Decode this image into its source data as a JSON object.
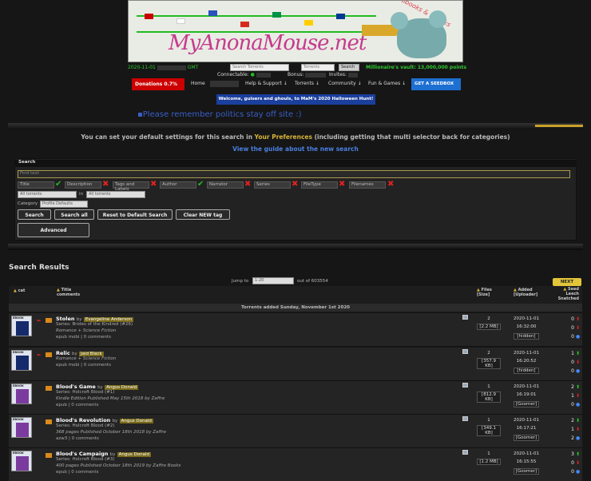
{
  "banner": {
    "logo_text": "MyAnonaMouse.net",
    "tagline": "audiobooks & ebooks"
  },
  "stats": {
    "date_prefix": "2020-11-01",
    "date_suffix": "GMT",
    "search_placeholder": "Search Torrents",
    "search_select": "Torrents",
    "search_button": "Search",
    "wedge_text": "Millionaire's vault: 13,000,000 points",
    "connectable_label": "Connectable:",
    "bonus_label": "Bonus:",
    "invites_label": "Invites:"
  },
  "nav": {
    "donations": "Donations 0.7%",
    "home": "Home",
    "help": "Help & Support ↓",
    "torrents": "Torrents ↓",
    "community": "Community ↓",
    "fun": "Fun & Games ↓",
    "seedbox": "GET A SEEDBOX"
  },
  "halloween": "Welcome, guisers and ghouls, to MaM's 2020 Halloween Hunt!",
  "politics": "Please remember politics stay off site :)",
  "prefs": {
    "pre": "You can set your default settings for this search in ",
    "link": "Your Preferences",
    "post": " (including getting that multi selector back for categories)"
  },
  "guide": "View the guide about the new search",
  "search": {
    "header": "Search",
    "find_placeholder": "Find text",
    "fields": [
      {
        "label": "Title",
        "checked": true
      },
      {
        "label": "Description",
        "checked": false
      },
      {
        "label": "Tags and Labels",
        "checked": false
      },
      {
        "label": "Author",
        "checked": true
      },
      {
        "label": "Narrator",
        "checked": false
      },
      {
        "label": "Series",
        "checked": false
      },
      {
        "label": "FileType",
        "checked": false
      },
      {
        "label": "Filenames",
        "checked": false
      }
    ],
    "scope1": "All torrents",
    "in_label": "in",
    "scope2": "All torrents",
    "category_label": "Category",
    "category_value": "Profile Defaults",
    "btn_search": "Search",
    "btn_search_all": "Search all",
    "btn_reset": "Reset to Default Search",
    "btn_clear": "Clear NEW tag",
    "btn_advanced": "Advanced"
  },
  "results": {
    "title": "Search Results",
    "jump_label": "Jump to",
    "jump_value": "1-20",
    "out_of": "out of 603554",
    "next": "NEXT",
    "col_cat": "cat",
    "col_title": "Title",
    "col_comments": "comments",
    "col_files": "Files",
    "col_size": "[Size]",
    "col_added": "Added",
    "col_uploader": "[Uploader]",
    "col_seed": "Seed",
    "col_leech": "Leech",
    "col_snatched": "Snatched",
    "date_band": "Torrents added Sunday, November 1st 2020"
  },
  "rows": [
    {
      "title": "Stolen",
      "author": "Evangeline Anderson",
      "line2": "Series:  Brides of the Kindred  (#26)",
      "line3": "Romance + Science Fiction",
      "tags": "epub  mobi  | 0 comments",
      "files": "2",
      "size": "[2.2 MB]",
      "date": "2020-11-01",
      "time": "16:32:00",
      "uploader": "[hidden]",
      "seed": "0",
      "leech": "0",
      "snatched": "0"
    },
    {
      "title": "Relic",
      "author": "Jaid Black",
      "line2": "Romance + Science Fiction",
      "line3": "",
      "tags": "epub  mobi  | 0 comments",
      "files": "2",
      "size": "[357.9 KB]",
      "date": "2020-11-01",
      "time": "16:20:52",
      "uploader": "[hidden]",
      "seed": "1",
      "leech": "0",
      "snatched": "0"
    },
    {
      "title": "Blood's Game",
      "author": "Angus Donald",
      "line2": "Series:  Holcroft Blood  (#1)",
      "line3": "Kindle Edition Published May 15th 2018 by Zaffre",
      "tags": "epub  | 0 comments",
      "files": "1",
      "size": "[812.9 KB]",
      "date": "2020-11-01",
      "time": "16:19:01",
      "uploader": "[Goomer]",
      "seed": "2",
      "leech": "1",
      "snatched": "0"
    },
    {
      "title": "Blood's Revolution",
      "author": "Angus Donald",
      "line2": "Series:  Holcroft Blood  (#2)",
      "line3": "368 pages Published October 18th 2018 by Zaffre",
      "tags": "azw3  | 0 comments",
      "files": "1",
      "size": "[349.1 KB]",
      "date": "2020-11-01",
      "time": "16:17:21",
      "uploader": "[Goomer]",
      "seed": "2",
      "leech": "1",
      "snatched": "2"
    },
    {
      "title": "Blood's Campaign",
      "author": "Angus Donald",
      "line2": "Series:  Holcroft Blood  (#3)",
      "line3": "400 pages Published October 18th 2019 by Zaffre Books",
      "tags": "epub  | 0 comments",
      "files": "1",
      "size": "[1.2 MB]",
      "date": "2020-11-01",
      "time": "16:15:55",
      "uploader": "[Goomer]",
      "seed": "3",
      "leech": "0",
      "snatched": "0"
    }
  ]
}
